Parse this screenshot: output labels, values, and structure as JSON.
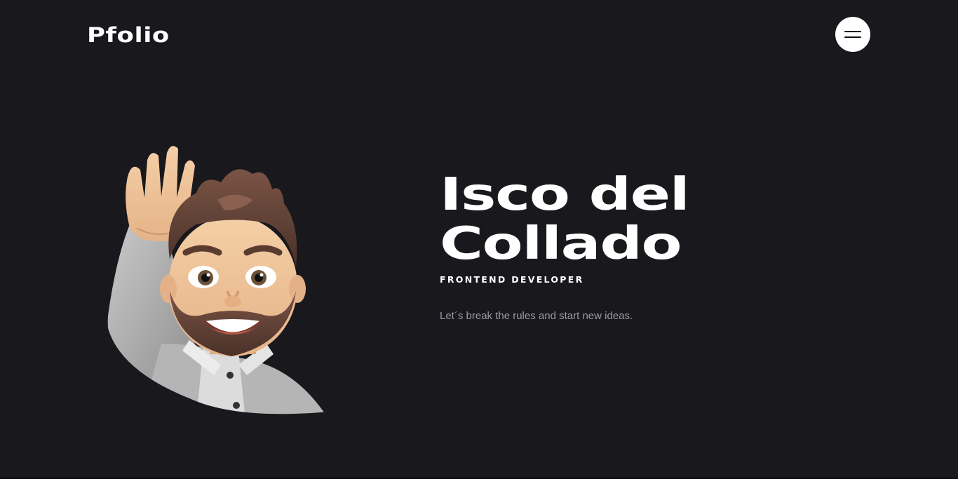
{
  "header": {
    "logo_text": "Pfolio",
    "menu_icon": "hamburger-menu-icon"
  },
  "hero": {
    "name_line_1": "Isco del",
    "name_line_2": "Collado",
    "role": "FRONTEND DEVELOPER",
    "tagline": "Let´s break the rules and start new ideas.",
    "avatar_icon": "waving-memoji-avatar"
  },
  "colors": {
    "background": "#18181d",
    "text_primary": "#ffffff",
    "text_muted": "#9a9aa6",
    "menu_button_bg": "#ffffff"
  }
}
